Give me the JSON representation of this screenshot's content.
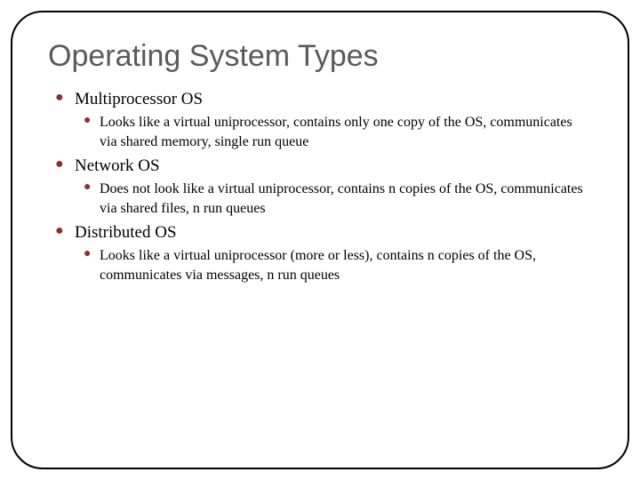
{
  "title": "Operating System Types",
  "items": [
    {
      "label": "Multiprocessor OS",
      "sub": [
        "Looks like a virtual uniprocessor, contains only one copy of the OS, communicates via shared memory, single run queue"
      ]
    },
    {
      "label": "Network OS",
      "sub": [
        "Does not look like a virtual uniprocessor, contains n copies of the OS, communicates via shared files, n run queues"
      ]
    },
    {
      "label": "Distributed OS",
      "sub": [
        "Looks like a virtual uniprocessor (more or less), contains n copies of the OS, communicates via messages, n run queues"
      ]
    }
  ]
}
